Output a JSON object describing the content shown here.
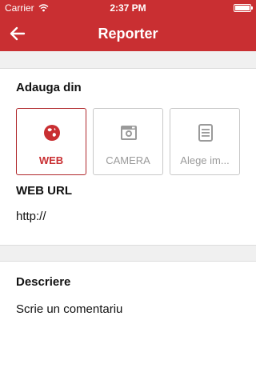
{
  "status_bar": {
    "carrier": "Carrier",
    "time": "2:37 PM"
  },
  "nav": {
    "title": "Reporter",
    "back_icon": "arrow-left-icon"
  },
  "add_from": {
    "heading": "Adauga din",
    "options": [
      {
        "label": "WEB",
        "icon": "globe-icon",
        "selected": true
      },
      {
        "label": "CAMERA",
        "icon": "camera-icon",
        "selected": false
      },
      {
        "label": "Alege im...",
        "icon": "document-icon",
        "selected": false
      }
    ],
    "url_label": "WEB URL",
    "url_value": "http://"
  },
  "description": {
    "heading": "Descriere",
    "placeholder": "Scrie un comentariu"
  },
  "colors": {
    "accent": "#c92f32",
    "background": "#f0f0f0",
    "inactive": "#9a9a9a"
  }
}
